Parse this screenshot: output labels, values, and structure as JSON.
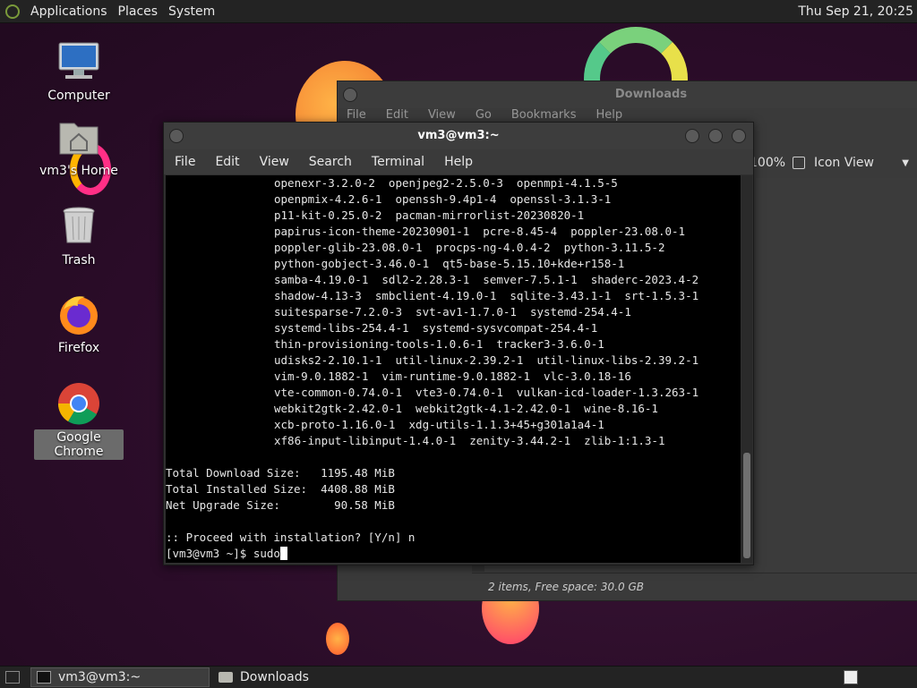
{
  "top_panel": {
    "menus": [
      "Applications",
      "Places",
      "System"
    ],
    "clock": "Thu Sep 21, 20:25"
  },
  "desktop_icons": [
    {
      "label": "Computer",
      "icon": "computer-icon"
    },
    {
      "label": "vm3's Home",
      "icon": "home-folder-icon"
    },
    {
      "label": "Trash",
      "icon": "trash-icon"
    },
    {
      "label": "Firefox",
      "icon": "firefox-icon"
    },
    {
      "label": "Google Chrome",
      "icon": "chrome-icon"
    }
  ],
  "file_manager": {
    "title": "Downloads",
    "menus": [
      "File",
      "Edit",
      "View",
      "Go",
      "Bookmarks",
      "Help"
    ],
    "zoom": "100%",
    "view_mode": "Icon View",
    "status": "2 items, Free space: 30.0 GB"
  },
  "terminal": {
    "title": "vm3@vm3:~",
    "menus": [
      "File",
      "Edit",
      "View",
      "Search",
      "Terminal",
      "Help"
    ],
    "package_lines": [
      "openexr-3.2.0-2  openjpeg2-2.5.0-3  openmpi-4.1.5-5",
      "openpmix-4.2.6-1  openssh-9.4p1-4  openssl-3.1.3-1",
      "p11-kit-0.25.0-2  pacman-mirrorlist-20230820-1",
      "papirus-icon-theme-20230901-1  pcre-8.45-4  poppler-23.08.0-1",
      "poppler-glib-23.08.0-1  procps-ng-4.0.4-2  python-3.11.5-2",
      "python-gobject-3.46.0-1  qt5-base-5.15.10+kde+r158-1",
      "samba-4.19.0-1  sdl2-2.28.3-1  semver-7.5.1-1  shaderc-2023.4-2",
      "shadow-4.13-3  smbclient-4.19.0-1  sqlite-3.43.1-1  srt-1.5.3-1",
      "suitesparse-7.2.0-3  svt-av1-1.7.0-1  systemd-254.4-1",
      "systemd-libs-254.4-1  systemd-sysvcompat-254.4-1",
      "thin-provisioning-tools-1.0.6-1  tracker3-3.6.0-1",
      "udisks2-2.10.1-1  util-linux-2.39.2-1  util-linux-libs-2.39.2-1",
      "vim-9.0.1882-1  vim-runtime-9.0.1882-1  vlc-3.0.18-16",
      "vte-common-0.74.0-1  vte3-0.74.0-1  vulkan-icd-loader-1.3.263-1",
      "webkit2gtk-2.42.0-1  webkit2gtk-4.1-2.42.0-1  wine-8.16-1",
      "xcb-proto-1.16.0-1  xdg-utils-1.1.3+45+g301a1a4-1",
      "xf86-input-libinput-1.4.0-1  zenity-3.44.2-1  zlib-1:1.3-1"
    ],
    "summary_lines": [
      "Total Download Size:   1195.48 MiB",
      "Total Installed Size:  4408.88 MiB",
      "Net Upgrade Size:        90.58 MiB"
    ],
    "proceed_line": ":: Proceed with installation? [Y/n] n",
    "prompt": "[vm3@vm3 ~]$ ",
    "typed_command": "sudo"
  },
  "taskbar": {
    "tasks": [
      {
        "label": "vm3@vm3:~",
        "active": true
      },
      {
        "label": "Downloads",
        "active": false
      }
    ]
  }
}
